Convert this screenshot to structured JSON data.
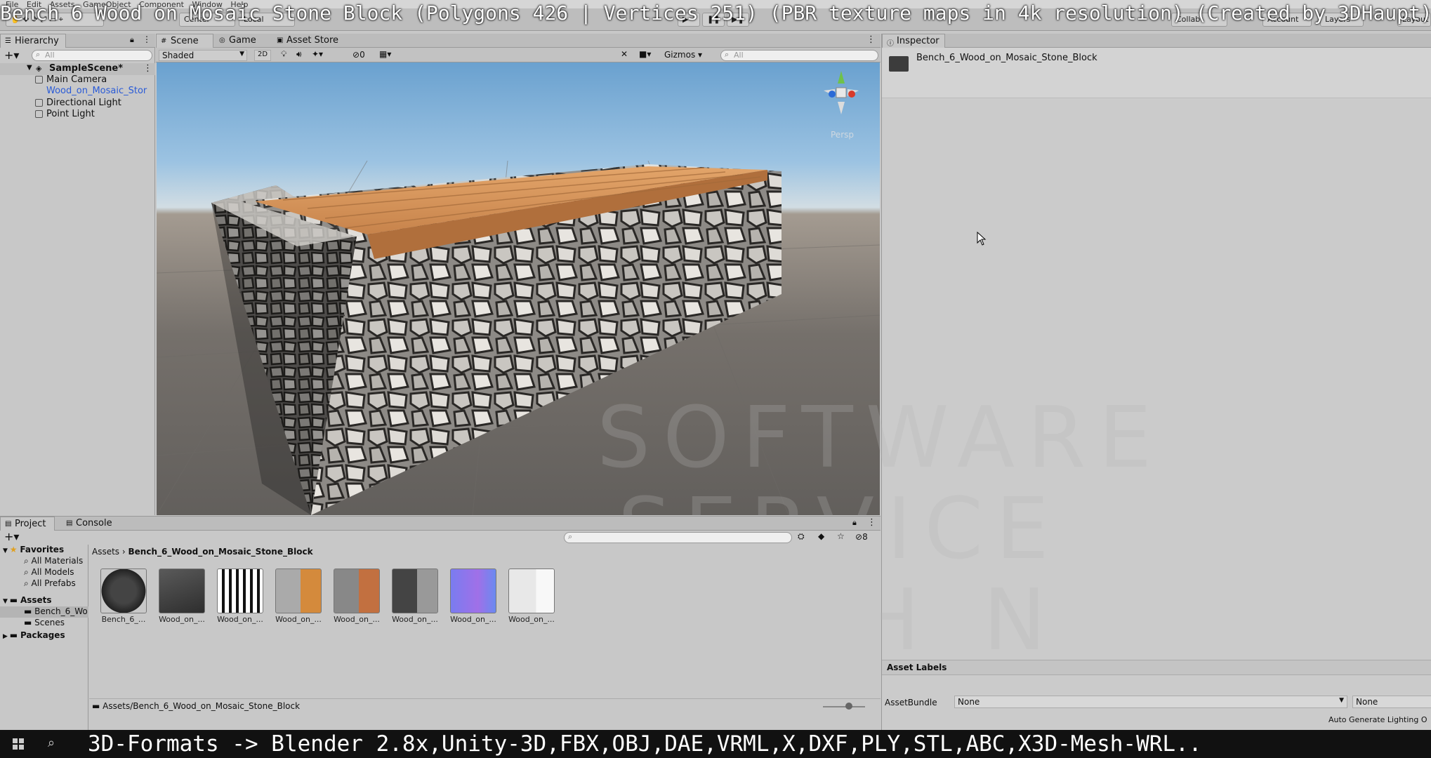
{
  "overlay": {
    "title": "Bench 6 Wood on Mosaic Stone Block (Polygons 426 | Vertices 251) (PBR texture maps in 4k resolution) (Created by 3DHaupt)",
    "bottom": "3D-Formats -> Blender 2.8x,Unity-3D,FBX,OBJ,DAE,VRML,X,DXF,PLY,STL,ABC,X3D-Mesh-WRL.."
  },
  "menu": [
    "File",
    "Edit",
    "Assets",
    "GameObject",
    "Component",
    "Window",
    "Help"
  ],
  "toolbar": {
    "center": "Center",
    "local": "Local",
    "collab": "Collab",
    "account": "Account",
    "layers": "Layers",
    "layout": "Layout"
  },
  "hierarchy": {
    "tab": "Hierarchy",
    "search": "All",
    "scene": "SampleScene*",
    "items": [
      "Main Camera",
      "Wood_on_Mosaic_Stor",
      "Directional Light",
      "Point Light"
    ]
  },
  "scene": {
    "tabs": [
      "Scene",
      "Game",
      "Asset Store"
    ],
    "shading": "Shaded",
    "mode2d": "2D",
    "hidden_count": "0",
    "gizmos": "Gizmos",
    "search": "All",
    "persp": "Persp"
  },
  "inspector": {
    "tab": "Inspector",
    "object_name": "Bench_6_Wood_on_Mosaic_Stone_Block",
    "asset_labels": "Asset Labels",
    "assetbundle_label": "AssetBundle",
    "assetbundle_value": "None",
    "variant_value": "None",
    "auto_lighting": "Auto Generate Lighting O"
  },
  "project": {
    "tabs": [
      "Project",
      "Console"
    ],
    "hidden_count": "8",
    "favorites": "Favorites",
    "fav_items": [
      "All Materials",
      "All Models",
      "All Prefabs"
    ],
    "assets": "Assets",
    "asset_folders": [
      "Bench_6_Wo",
      "Scenes"
    ],
    "packages": "Packages",
    "breadcrumb_root": "Assets",
    "breadcrumb_folder": "Bench_6_Wood_on_Mosaic_Stone_Block",
    "thumb_labels": [
      "Bench_6_...",
      "Wood_on_...",
      "Wood_on_...",
      "Wood_on_...",
      "Wood_on_...",
      "Wood_on_...",
      "Wood_on_...",
      "Wood_on_..."
    ],
    "status_path": "Assets/Bench_6_Wood_on_Mosaic_Stone_Block"
  },
  "watermark": [
    "SOFTWARE",
    "SERVICE",
    "JOHN"
  ]
}
